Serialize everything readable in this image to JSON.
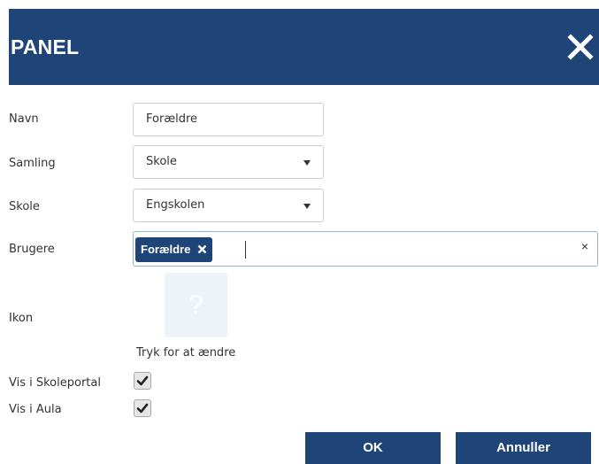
{
  "header": {
    "title": "PANEL",
    "close_icon": "close-icon"
  },
  "form": {
    "name": {
      "label": "Navn",
      "value": "Forældre"
    },
    "collection": {
      "label": "Samling",
      "value": "Skole",
      "icon": "chevron-down-icon"
    },
    "school": {
      "label": "Skole",
      "value": "Engskolen",
      "icon": "chevron-down-icon"
    },
    "users": {
      "label": "Brugere",
      "tags": [
        {
          "label": "Forældre",
          "remove_icon": "close-icon"
        }
      ],
      "clear_symbol": "×"
    },
    "icon": {
      "label": "Ikon",
      "placeholder_symbol": "?",
      "hint": "Tryk for at ændre"
    },
    "show_in_school_portal": {
      "label": "Vis i Skoleportal",
      "checked": true
    },
    "show_in_aula": {
      "label": "Vis i Aula",
      "checked": true
    }
  },
  "buttons": {
    "ok": "OK",
    "cancel": "Annuller"
  },
  "colors": {
    "primary": "#1f4578",
    "focus_border": "#8fb6de",
    "icon_bg": "#eef3f9"
  }
}
